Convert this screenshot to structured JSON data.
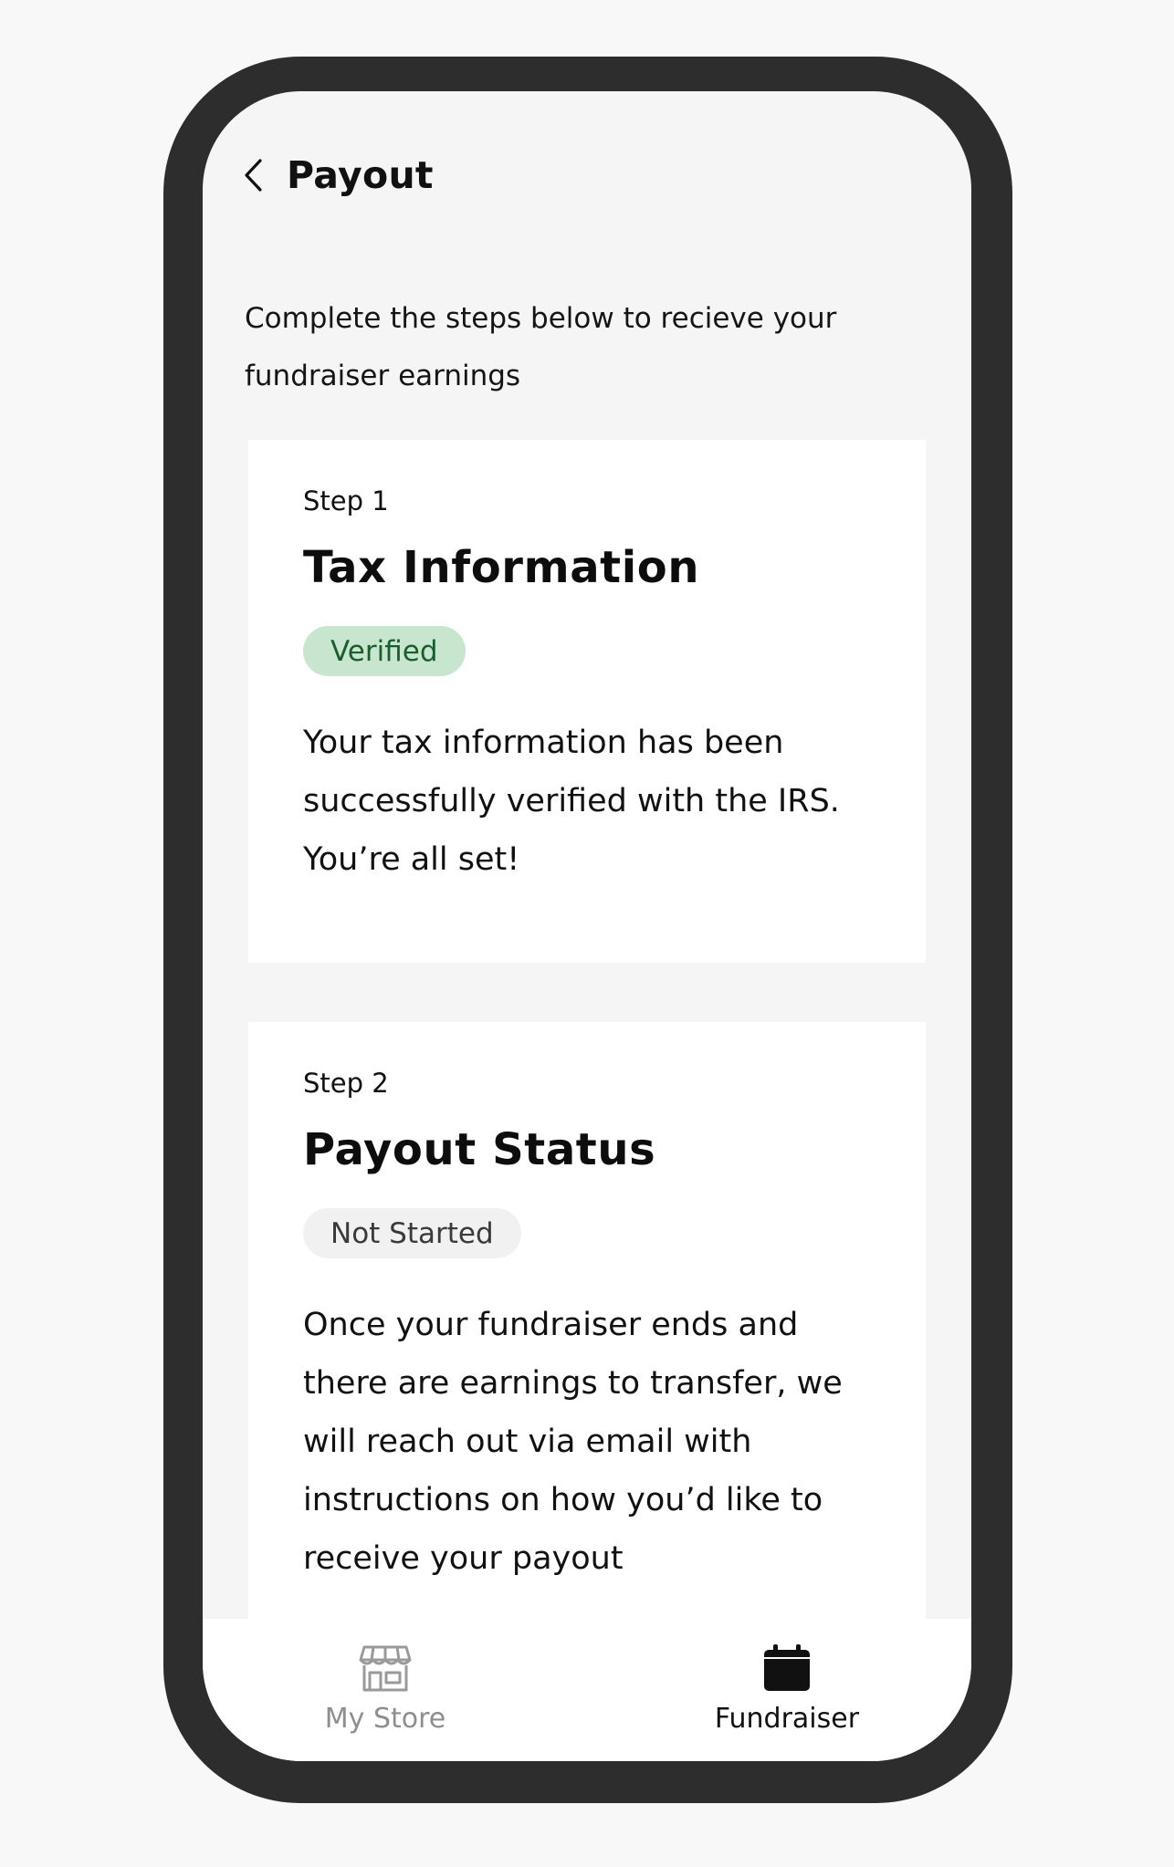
{
  "header": {
    "title": "Payout",
    "back_icon": "chevron-left-icon"
  },
  "intro": {
    "text": "Complete the steps below to recieve your fundraiser earnings"
  },
  "steps": [
    {
      "step_label": "Step 1",
      "title": "Tax Information",
      "status": "Verified",
      "status_color": "#c8e6cf",
      "status_text_color": "#1b5e2e",
      "description": "Your tax information has been successfully verified with the IRS. You’re all set!"
    },
    {
      "step_label": "Step 2",
      "title": "Payout Status",
      "status": "Not Started",
      "status_color": "#f1f1f1",
      "status_text_color": "#3a3a3a",
      "description": "Once your fundraiser ends and there are earnings to transfer, we will reach out via email with instructions on how you’d like to receive your payout"
    }
  ],
  "tabbar": {
    "items": [
      {
        "label": "My Store",
        "icon": "store-icon",
        "active": false
      },
      {
        "label": "Fundraiser",
        "icon": "calendar-icon",
        "active": true
      }
    ]
  },
  "colors": {
    "phone_frame": "#2d2d2d",
    "screen_background": "#f5f5f5",
    "card_background": "#ffffff",
    "inactive_tab": "#8e8e8e",
    "active_tab": "#111111"
  }
}
